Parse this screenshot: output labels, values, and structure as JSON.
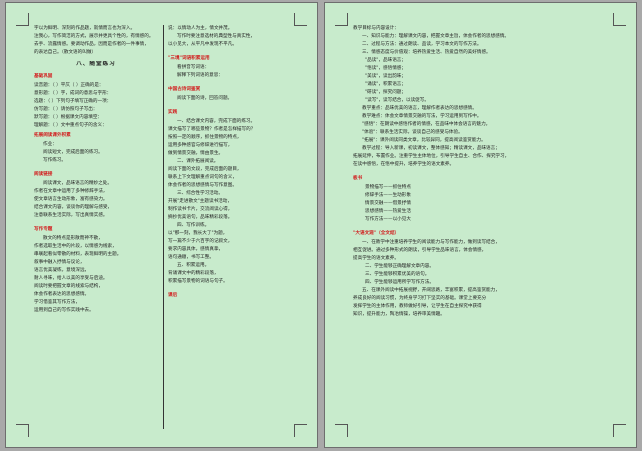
{
  "left_page": {
    "col_a": [
      {
        "t": "字以为鲜明、深刻的作品题，就情而言也为深入。",
        "c": ""
      },
      {
        "t": "注我心，写作简洁的方式，展示并更具个性的，有情感的。",
        "c": ""
      },
      {
        "t": "去手、流露情感。要调动作品，因而是作者的一件事情，",
        "c": ""
      },
      {
        "t": "的表达自己。（散文语的叫做）",
        "c": ""
      },
      {
        "t": "八、随堂练习",
        "c": "sec"
      },
      {
        "t": "基础巩固",
        "c": "red"
      },
      {
        "t": "读音题：（ ）平仄（ ）正确的是：",
        "c": ""
      },
      {
        "t": "意形题：（ ）字，成词的意思与字形：",
        "c": ""
      },
      {
        "t": "选题：（ ）下列句子填写正确的一项：",
        "c": ""
      },
      {
        "t": "仿写题：（ ）请仿照句子写出：",
        "c": ""
      },
      {
        "t": "默写题：（ ）根据课文内容填空：",
        "c": ""
      },
      {
        "t": "理解题：（ ）文中重点句子的含义：",
        "c": ""
      },
      {
        "t": "拓展阅读课外积累",
        "c": "red"
      },
      {
        "t": "作业：",
        "c": "ind"
      },
      {
        "t": "阅读短文，完成后面的练习。",
        "c": "ind"
      },
      {
        "t": "写作练习。",
        "c": "ind"
      },
      {
        "t": "",
        "c": "gap"
      },
      {
        "t": "阅读链接",
        "c": "red"
      },
      {
        "t": "阅读课文，品味语言的精妙之处。",
        "c": "ind"
      },
      {
        "t": "作者在文章中运用了多种修辞手法，",
        "c": ""
      },
      {
        "t": "使文章语言生动形象，富有感染力。",
        "c": ""
      },
      {
        "t": "结合课文内容，谈谈你的理解与感受，",
        "c": ""
      },
      {
        "t": "注意联系生活实际，写出真情实感。",
        "c": ""
      },
      {
        "t": "",
        "c": "gap"
      },
      {
        "t": "写作专题",
        "c": "red"
      },
      {
        "t": "散文的特点是形散而神不散，",
        "c": "ind"
      },
      {
        "t": "作者选取生活中的片段，以情感为线索，",
        "c": ""
      },
      {
        "t": "串联起看似零散的材料，表现鲜明的主题。",
        "c": ""
      },
      {
        "t": "叙事中融入抒情与议论，",
        "c": ""
      },
      {
        "t": "语言优美凝练，意境深远，",
        "c": ""
      },
      {
        "t": "耐人寻味，给人以美的享受与启迪。",
        "c": ""
      },
      {
        "t": "阅读时要把握文章的线索与结构，",
        "c": ""
      },
      {
        "t": "体会作者表达的思想感情。",
        "c": ""
      },
      {
        "t": "学习借鉴其写作方法，",
        "c": ""
      },
      {
        "t": "运用到自己的写作实践中去。",
        "c": ""
      }
    ],
    "col_b": [
      {
        "t": "说：以情动人为主，情文并茂。",
        "c": ""
      },
      {
        "t": "写作时要注意选材的典型性与真实性，",
        "c": "ind"
      },
      {
        "t": "以小见大，从平凡中发现不平凡。",
        "c": ""
      },
      {
        "t": "",
        "c": "gap"
      },
      {
        "t": "\"三境\"词语积累运用",
        "c": "red"
      },
      {
        "t": "看拼音写词语：",
        "c": "ind"
      },
      {
        "t": "解释下列词语的意思：",
        "c": "ind"
      },
      {
        "t": "",
        "c": "gap"
      },
      {
        "t": "中国古诗词鉴赏",
        "c": "red"
      },
      {
        "t": "阅读下面的诗，回答问题。",
        "c": "ind"
      },
      {
        "t": "",
        "c": "gap"
      },
      {
        "t": "实践",
        "c": "red"
      },
      {
        "t": "一、结合课文内容，完成下面的练习。",
        "c": "ind"
      },
      {
        "t": "课文描写了哪些景物？作者是怎样描写的？",
        "c": ""
      },
      {
        "t": "按照一定的顺序，抓住景物的特点，",
        "c": ""
      },
      {
        "t": "运用多种感官与修辞进行描写，",
        "c": ""
      },
      {
        "t": "做到情景交融，情由景生。",
        "c": ""
      },
      {
        "t": "二、课外拓展阅读。",
        "c": "ind"
      },
      {
        "t": "阅读下面的文段，完成后面的题目，",
        "c": ""
      },
      {
        "t": "联系上下文理解重点词句的含义，",
        "c": ""
      },
      {
        "t": "体会作者的思想感情与写作意图。",
        "c": ""
      },
      {
        "t": "三、综合性学习活动。",
        "c": "ind"
      },
      {
        "t": "开展\"走进散文\"主题读书活动，",
        "c": ""
      },
      {
        "t": "制作读书卡片，交流阅读心得，",
        "c": ""
      },
      {
        "t": "摘抄优美语句，品味精彩段落。",
        "c": ""
      },
      {
        "t": "四、写作训练。",
        "c": "ind"
      },
      {
        "t": "以\"那一刻，我长大了\"为题，",
        "c": ""
      },
      {
        "t": "写一篇不少于六百字的记叙文，",
        "c": ""
      },
      {
        "t": "要求内容具体，感情真挚，",
        "c": ""
      },
      {
        "t": "语句通顺，书写工整。",
        "c": ""
      },
      {
        "t": "五、积累运用。",
        "c": "ind"
      },
      {
        "t": "背诵课文中的精彩段落，",
        "c": ""
      },
      {
        "t": "积累描写景物的词语与句子。",
        "c": ""
      },
      {
        "t": "",
        "c": "gap"
      },
      {
        "t": "课后",
        "c": "red"
      }
    ]
  },
  "right_page": {
    "col_c": [
      {
        "t": "教学目标与内容设计：",
        "c": ""
      },
      {
        "t": "一、知识与能力：理解课文内容，把握文章主旨，体会作者的思想感情。",
        "c": "ind"
      },
      {
        "t": "二、过程与方法：通过朗读、品读，学习本文的写作方法。",
        "c": "ind"
      },
      {
        "t": "三、情感态度与价值观：培养热爱生活、热爱自然的美好情感。",
        "c": "ind"
      },
      {
        "t": "\"品读\"，品味语言；",
        "c": "ind2"
      },
      {
        "t": "\"悟读\"，感悟情感；",
        "c": "ind2"
      },
      {
        "t": "\"美读\"，读出韵味；",
        "c": "ind2"
      },
      {
        "t": "\"诵读\"，积累语言；",
        "c": "ind2"
      },
      {
        "t": "\"研读\"，探究问题；",
        "c": "ind2"
      },
      {
        "t": "\"读写\"，读写结合，以读促写。",
        "c": "ind2"
      },
      {
        "t": "教学重点：品味优美的语言，理解作者表达的思想感情。",
        "c": "ind"
      },
      {
        "t": "教学难点：体会文章情景交融的写法，学习运用到写作中。",
        "c": "ind"
      },
      {
        "t": "\"感悟\"：在朗读中感悟作者的情感，在品味中体会语言的魅力。",
        "c": "ind"
      },
      {
        "t": "\"体验\"：联系生活实际，谈谈自己的感受与体验。",
        "c": "ind"
      },
      {
        "t": "\"拓展\"：课外阅读同类文章，比较异同，提高阅读鉴赏能力。",
        "c": "ind"
      },
      {
        "t": "教学过程：导入新课，初读课文，整体感知；精读课文，品味语言；",
        "c": "ind"
      },
      {
        "t": "拓展延伸，布置作业。注重学生主体地位，引导学生自主、合作、探究学习，",
        "c": ""
      },
      {
        "t": "在读中感悟，在悟中提升，培养学生的语文素养。",
        "c": ""
      },
      {
        "t": "",
        "c": "gap"
      },
      {
        "t": "板书",
        "c": "red"
      },
      {
        "t": "景物描写——抓住特点",
        "c": "ind2"
      },
      {
        "t": "修辞手法——生动形象",
        "c": "ind2"
      },
      {
        "t": "情景交融——借景抒情",
        "c": "ind2"
      },
      {
        "t": "思想感情——热爱生活",
        "c": "ind2"
      },
      {
        "t": "写作方法——以小见大",
        "c": "ind2"
      },
      {
        "t": "",
        "c": "gap"
      },
      {
        "t": "\"大语文观\"（全文结）",
        "c": "red"
      },
      {
        "t": "一、在教学中注重培养学生的阅读能力与写作能力，做到读写结合，",
        "c": "ind"
      },
      {
        "t": "相互促进。通过多种形式的朗读，引导学生品味语言，体会情感，",
        "c": ""
      },
      {
        "t": "提高学生的语文素养。",
        "c": ""
      },
      {
        "t": "二、学生能够正确理解文章内容。",
        "c": "ind2"
      },
      {
        "t": "三、学生能够积累优美的语句。",
        "c": "ind2"
      },
      {
        "t": "四、学生能够运用所学写作方法。",
        "c": "ind2"
      },
      {
        "t": "五、在课外阅读中拓展视野，开阔思路，丰富积累，提高鉴赏能力，",
        "c": "ind"
      },
      {
        "t": "养成良好的阅读习惯，为终身学习打下坚实的基础。课堂上要充分",
        "c": ""
      },
      {
        "t": "发挥学生的主体作用，教师做好引导，让学生在自主探究中获得",
        "c": ""
      },
      {
        "t": "知识，提升能力，陶冶情操，培养审美情趣。",
        "c": ""
      }
    ]
  }
}
